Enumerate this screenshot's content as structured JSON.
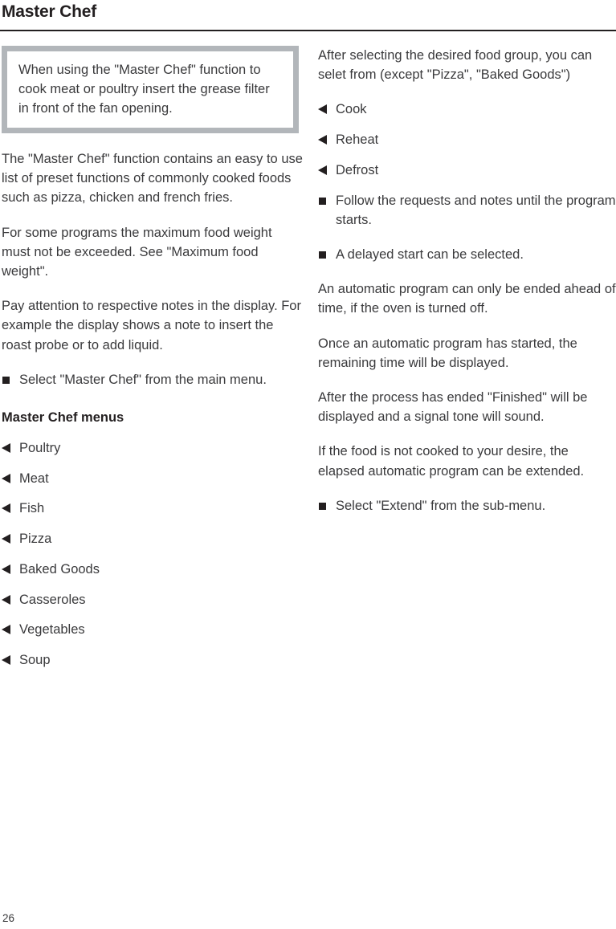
{
  "page": {
    "title": "Master Chef",
    "number": "26"
  },
  "notebox": {
    "text": "When using the \"Master Chef\" function to cook meat or poultry insert the grease filter in front of the fan opening."
  },
  "left_column": {
    "paragraphs": [
      "The \"Master Chef\" function contains an easy to use list of preset functions of commonly cooked foods such as pizza, chicken and french fries.",
      "For some programs the maximum food weight must not be exceeded. See \"Maximum food weight\".",
      "Pay attention to respective notes in the display. For example the display shows a note to insert the roast probe or to add liquid."
    ],
    "step": "Select \"Master Chef\" from the main menu.",
    "menus_heading": "Master Chef menus",
    "menus": [
      "Poultry",
      "Meat",
      "Fish",
      "Pizza",
      "Baked Goods",
      "Casseroles",
      "Vegetables",
      "Soup"
    ]
  },
  "right_column": {
    "intro": "After selecting the desired food group, you can selet from (except \"Pizza\", \"Baked Goods\")",
    "modes": [
      "Cook",
      "Reheat",
      "Defrost"
    ],
    "steps_after_modes": [
      "Follow the requests and notes until the program starts.",
      "A delayed start can be selected."
    ],
    "paragraphs": [
      "An automatic program can only be ended ahead of time, if the oven is turned off.",
      "Once an automatic program has started, the remaining time will be displayed.",
      "After the process has ended \"Finished\" will be displayed and a signal tone will sound.",
      "If the food is not cooked to your desire, the elapsed automatic program can be extended."
    ],
    "final_step": "Select \"Extend\" from the sub-menu."
  }
}
